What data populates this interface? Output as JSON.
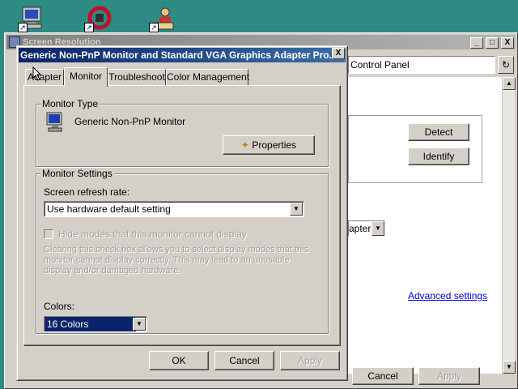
{
  "desktop": {
    "icons": [
      "my-computer-icon",
      "network-icon",
      "user-icon"
    ]
  },
  "background_window": {
    "title": "Screen Resolution",
    "address": "Control Panel",
    "detect_label": "Detect",
    "identify_label": "Identify",
    "combo_value": "apter",
    "advanced_link": "Advanced settings",
    "cancel_label": "Cancel",
    "apply_label": "Apply",
    "controls": {
      "minimize": "_",
      "maximize": "□",
      "close": "X"
    }
  },
  "dialog": {
    "title": "Generic Non-PnP Monitor and Standard VGA Graphics Adapter Pro...",
    "close_label": "X",
    "tabs": [
      "Adapter",
      "Monitor",
      "Troubleshoot",
      "Color Management"
    ],
    "active_tab": "Monitor",
    "monitor_type": {
      "label": "Monitor Type",
      "name": "Generic Non-PnP Monitor",
      "properties_label": "Properties"
    },
    "monitor_settings": {
      "label": "Monitor Settings",
      "refresh_label": "Screen refresh rate:",
      "refresh_value": "Use hardware default setting",
      "hide_modes_label": "Hide modes that this monitor cannot display",
      "description_lines": [
        "Clearing this check box allows you to select display modes that this",
        "monitor cannot display correctly. This may lead to an unusable",
        "display and/or damaged hardware."
      ]
    },
    "colors": {
      "label": "Colors:",
      "value": "16 Colors"
    },
    "buttons": {
      "ok": "OK",
      "cancel": "Cancel",
      "apply": "Apply"
    }
  }
}
